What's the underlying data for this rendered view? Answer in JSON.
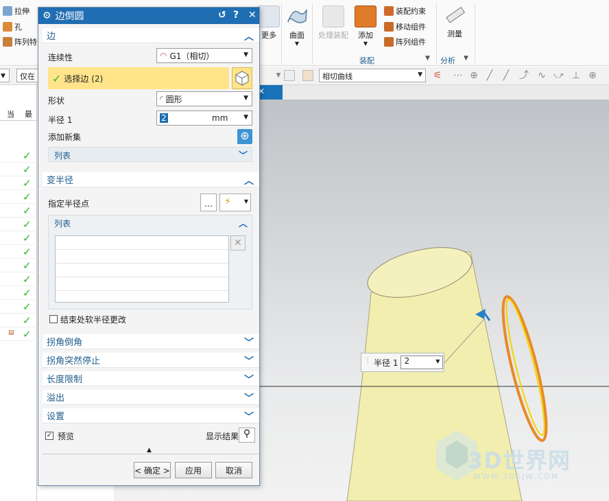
{
  "ribbon": {
    "left_items": [
      "拉伸",
      "孔",
      "阵列特"
    ],
    "more_label": "更多",
    "surface_label": "曲面",
    "assembly": {
      "process_label": "处理装配",
      "add_label": "添加",
      "constraint_label": "装配约束",
      "move_label": "移动组件",
      "array_label": "阵列组件",
      "group_label": "装配"
    },
    "analysis": {
      "measure_label": "测量",
      "group_label": "分析"
    }
  },
  "toolbar2": {
    "filter_value": "仅在工",
    "curve_rule_value": "相切曲线"
  },
  "navigator": {
    "col_current": "当",
    "col_latest": "最",
    "check_count": 14
  },
  "dialog": {
    "title": "边倒圆",
    "edge_section": {
      "title": "边",
      "continuity_label": "连续性",
      "continuity_value": "G1（相切）",
      "select_edge_label": "选择边 (2)",
      "shape_label": "形状",
      "shape_value": "圆形",
      "radius_label": "半径 1",
      "radius_value": "2",
      "radius_unit": "mm",
      "add_set_label": "添加新集",
      "list_label": "列表"
    },
    "variable_radius": {
      "title": "变半径",
      "specify_point_label": "指定半径点",
      "list_label": "列表",
      "soft_change_label": "结束处软半径更改"
    },
    "collapsed_sections": [
      "拐角倒角",
      "拐角突然停止",
      "长度限制",
      "溢出",
      "设置"
    ],
    "preview_label": "预览",
    "show_result_label": "显示结果",
    "ok_label": "< 确定 >",
    "apply_label": "应用",
    "cancel_label": "取消"
  },
  "viewport_tag": {
    "label": "半径 1",
    "value": "2"
  },
  "watermark": {
    "text": "3D世界网",
    "sub": "WWW.3DSJW.COM"
  },
  "colors": {
    "accent": "#1f6db2",
    "highlight": "#ffe48a",
    "part": "#f2eeb0",
    "edge": "#e8892a"
  }
}
